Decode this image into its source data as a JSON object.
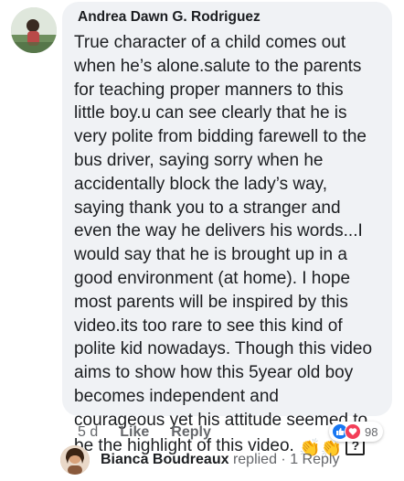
{
  "comment": {
    "author": "Andrea Dawn G. Rodriguez",
    "lines": [
      "True character of a child comes out",
      "when he’s alone.salute to the parents",
      "for teaching proper manners to this",
      "little boy.u can see clearly that he is",
      "very polite from bidding farewell to the",
      "bus driver, saying sorry when he",
      "accidentally block the lady’s way,",
      "saying thank you to a stranger and",
      "even the way he delivers his words...I",
      "would say that he is brought up in a",
      "good environment (at home). I hope",
      "most parents will be inspired by this",
      "video.its too rare to see this kind of",
      "polite kid nowadays. Though this video",
      "aims to show how this 5year old boy",
      "becomes independent and",
      "courageous yet his attitude seemed to"
    ],
    "last_line": "be the highlight of this video.",
    "emoji": "👏👏",
    "qmark": "?",
    "time": "5 d",
    "like_label": "Like",
    "reply_label": "Reply",
    "reactions": {
      "icons": [
        "like-reaction",
        "love-reaction"
      ],
      "count": "98",
      "like_color": "#1877f2",
      "love_color": "#f33e58"
    }
  },
  "reply_preview": {
    "name": "Bianca Boudreaux",
    "action": "replied",
    "separator": "·",
    "count_label": "1 Reply"
  },
  "colors": {
    "bubble": "#f0f2f5",
    "text": "#1c1e21",
    "muted": "#65676b"
  }
}
